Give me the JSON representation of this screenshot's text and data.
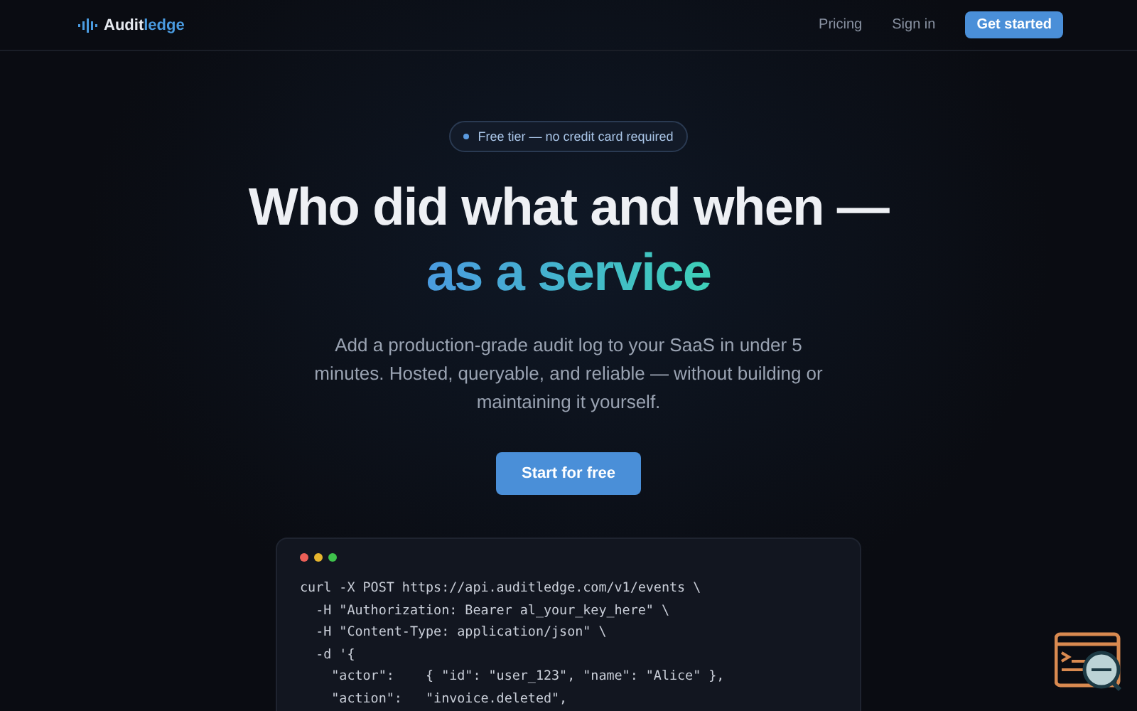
{
  "header": {
    "logo": {
      "part_1": "Audit",
      "part_2": "ledge"
    },
    "links": [
      "Pricing",
      "Sign in"
    ],
    "cta": "Get started"
  },
  "hero": {
    "badge": "Free tier — no credit card required",
    "title_line_1": "Who did what and when —",
    "title_line_2": "as a service",
    "subtitle": "Add a production-grade audit log to your SaaS in under 5 minutes. Hosted, queryable, and reliable — without building or maintaining it yourself.",
    "button": "Start for free"
  },
  "code_window": {
    "lines": [
      "curl -X POST https://api.auditledge.com/v1/events \\",
      "  -H \"Authorization: Bearer al_your_key_here\" \\",
      "  -H \"Content-Type: application/json\" \\",
      "  -d '{",
      "    \"actor\":    { \"id\": \"user_123\", \"name\": \"Alice\" },",
      "    \"action\":   \"invoice.deleted\","
    ]
  }
}
